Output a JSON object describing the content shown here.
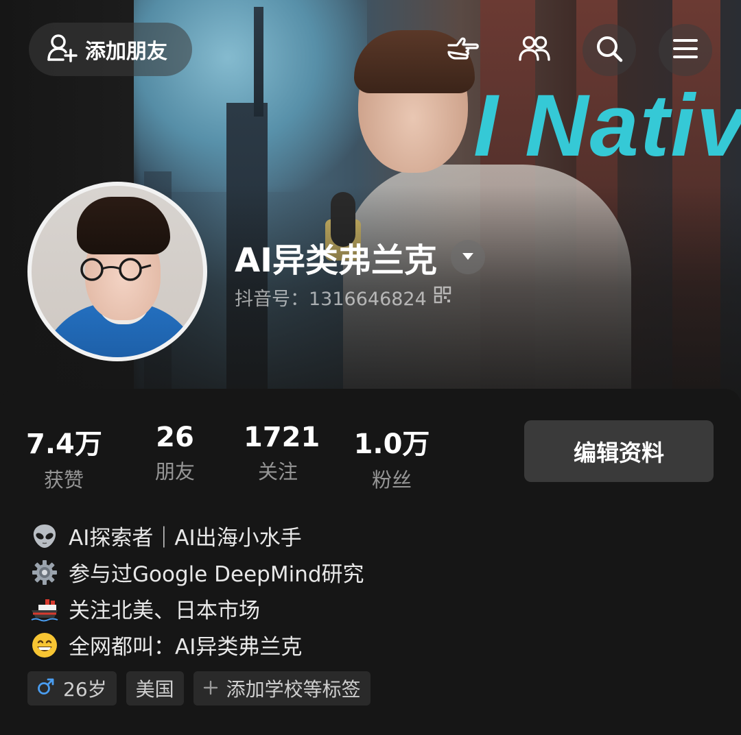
{
  "header": {
    "add_friend_label": "添加朋友",
    "cover_text": "I Nativ",
    "icons": [
      "add-friend-icon",
      "pointing-hand-icon",
      "friends-icon",
      "search-icon",
      "menu-icon"
    ]
  },
  "profile": {
    "name": "AI异类弗兰克",
    "douyin_id": "抖音号：1316646824"
  },
  "stats": [
    {
      "value": "7.4万",
      "label": "获赞"
    },
    {
      "value": "26",
      "label": "朋友"
    },
    {
      "value": "1721",
      "label": "关注"
    },
    {
      "value": "1.0万",
      "label": "粉丝"
    }
  ],
  "edit_profile_label": "编辑资料",
  "bio": [
    {
      "icon": "alien-emoji-icon",
      "text": "AI探索者｜AI出海小水手"
    },
    {
      "icon": "gear-emoji-icon",
      "text": "参与过Google DeepMind研究"
    },
    {
      "icon": "ship-emoji-icon",
      "text": "关注北美、日本市场"
    },
    {
      "icon": "grinning-face-emoji-icon",
      "text": "全网都叫：AI异类弗兰克"
    }
  ],
  "tags": {
    "age": "26岁",
    "region": "美国",
    "add_school": "添加学校等标签"
  },
  "colors": {
    "background": "#161616",
    "button": "#3a3a3a",
    "accent_cyan": "#35c9d6",
    "male_blue": "#4a9df0"
  }
}
